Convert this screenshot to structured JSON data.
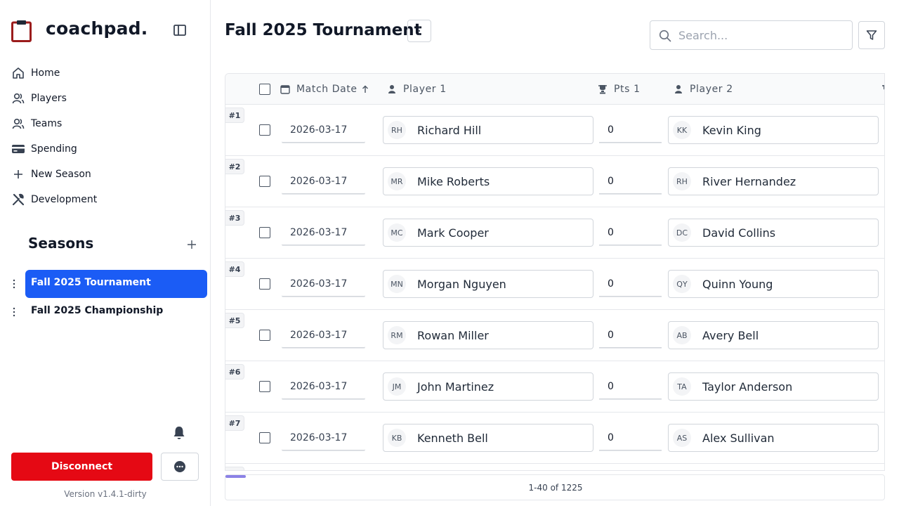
{
  "brand": {
    "name": "coachpad."
  },
  "nav": [
    {
      "label": "Home",
      "icon": "home-icon"
    },
    {
      "label": "Players",
      "icon": "players-icon"
    },
    {
      "label": "Teams",
      "icon": "teams-icon"
    },
    {
      "label": "Spending",
      "icon": "credit-card-icon"
    },
    {
      "label": "New Season",
      "icon": "plus-icon"
    },
    {
      "label": "Development",
      "icon": "tools-icon"
    }
  ],
  "seasons": {
    "title": "Seasons",
    "items": [
      {
        "label": "Fall 2025 Tournament",
        "active": true
      },
      {
        "label": "Fall 2025 Championship",
        "active": false
      }
    ]
  },
  "footer": {
    "disconnect_label": "Disconnect",
    "version": "Version v1.4.1-dirty"
  },
  "header": {
    "title": "Fall 2025 Tournament",
    "search_placeholder": "Search..."
  },
  "table": {
    "columns": {
      "match_date": "Match Date",
      "player1": "Player 1",
      "pts1": "Pts 1",
      "player2": "Player 2"
    },
    "rows": [
      {
        "num": "#1",
        "date": "2026-03-17",
        "p1_initials": "RH",
        "p1": "Richard Hill",
        "pts1": "0",
        "p2_initials": "KK",
        "p2": "Kevin King"
      },
      {
        "num": "#2",
        "date": "2026-03-17",
        "p1_initials": "MR",
        "p1": "Mike Roberts",
        "pts1": "0",
        "p2_initials": "RH",
        "p2": "River Hernandez"
      },
      {
        "num": "#3",
        "date": "2026-03-17",
        "p1_initials": "MC",
        "p1": "Mark Cooper",
        "pts1": "0",
        "p2_initials": "DC",
        "p2": "David Collins"
      },
      {
        "num": "#4",
        "date": "2026-03-17",
        "p1_initials": "MN",
        "p1": "Morgan Nguyen",
        "pts1": "0",
        "p2_initials": "QY",
        "p2": "Quinn Young"
      },
      {
        "num": "#5",
        "date": "2026-03-17",
        "p1_initials": "RM",
        "p1": "Rowan Miller",
        "pts1": "0",
        "p2_initials": "AB",
        "p2": "Avery Bell"
      },
      {
        "num": "#6",
        "date": "2026-03-17",
        "p1_initials": "JM",
        "p1": "John Martinez",
        "pts1": "0",
        "p2_initials": "TA",
        "p2": "Taylor Anderson"
      },
      {
        "num": "#7",
        "date": "2026-03-17",
        "p1_initials": "KB",
        "p1": "Kenneth Bell",
        "pts1": "0",
        "p2_initials": "AS",
        "p2": "Alex Sullivan"
      }
    ],
    "pager": "1-40 of 1225"
  },
  "colors": {
    "accent": "#1b5cf5",
    "danger": "#e50914"
  }
}
